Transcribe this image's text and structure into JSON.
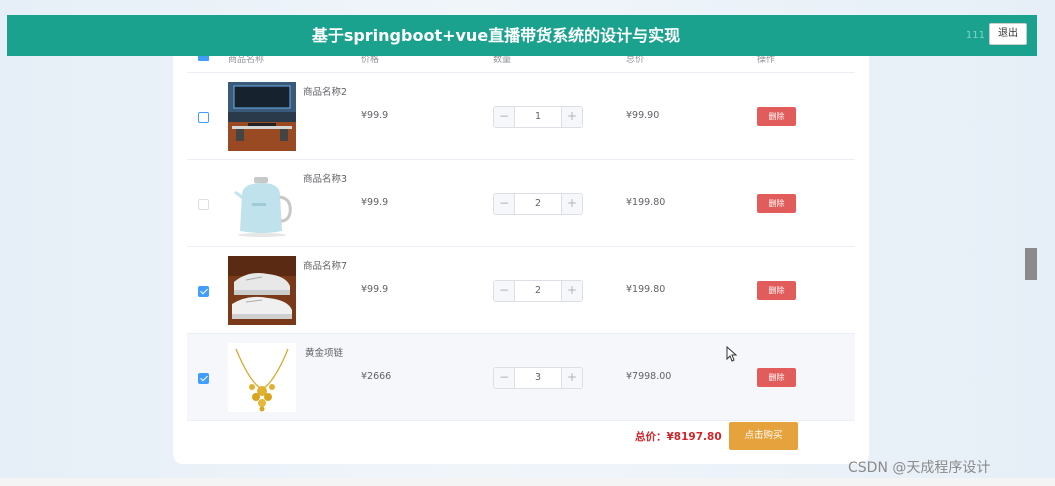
{
  "header": {
    "title": "基于springboot+vue直播带货系统的设计与实现",
    "user": "111",
    "logout_label": "退出"
  },
  "table": {
    "columns": [
      "商品名称",
      "价格",
      "数量",
      "总价",
      "操作"
    ],
    "rows": [
      {
        "name": "商品名称2",
        "price": "¥99.9",
        "quantity": "1",
        "subtotal": "¥99.90",
        "delete_label": "删除",
        "checked": false,
        "image": "desk-monitor-image"
      },
      {
        "name": "商品名称3",
        "price": "¥99.9",
        "quantity": "2",
        "subtotal": "¥199.80",
        "delete_label": "删除",
        "checked": false,
        "image": "kettle-image"
      },
      {
        "name": "商品名称7",
        "price": "¥99.9",
        "quantity": "2",
        "subtotal": "¥199.80",
        "delete_label": "删除",
        "checked": true,
        "image": "sneaker-image"
      },
      {
        "name": "黄金项链",
        "price": "¥2666",
        "quantity": "3",
        "subtotal": "¥7998.00",
        "delete_label": "删除",
        "checked": true,
        "image": "gold-necklace-image"
      }
    ]
  },
  "footer": {
    "total_label": "总价：¥8197.80",
    "buy_label": "点击购买"
  },
  "stepper": {
    "minus": "−",
    "plus": "+"
  },
  "watermark": "CSDN @天成程序设计",
  "colors": {
    "header_bg": "#1aa28e",
    "delete_btn": "#e25c5c",
    "buy_btn": "#e6a23c",
    "total_text": "#d0252b",
    "checkbox": "#409eff"
  }
}
